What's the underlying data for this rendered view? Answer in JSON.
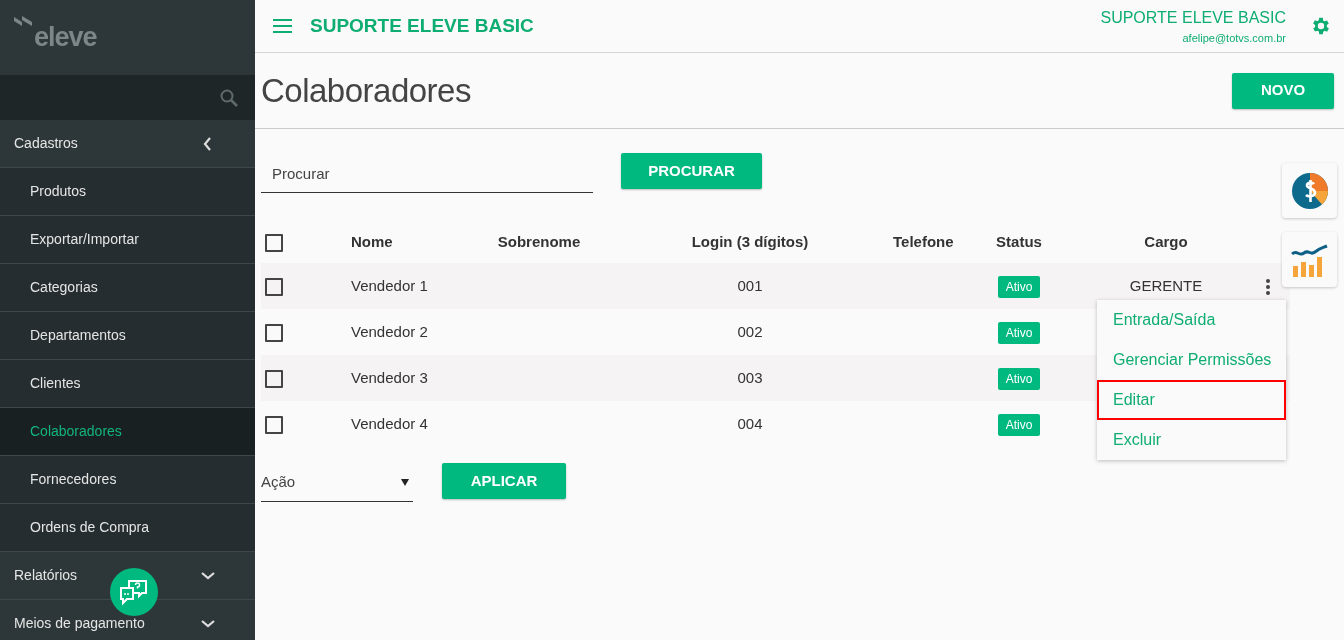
{
  "sidebar": {
    "logo": "eleve",
    "items": [
      {
        "label": "Cadastros",
        "expanded": true,
        "children": [
          {
            "label": "Produtos",
            "selected": false
          },
          {
            "label": "Exportar/Importar",
            "selected": false
          },
          {
            "label": "Categorias",
            "selected": false
          },
          {
            "label": "Departamentos",
            "selected": false
          },
          {
            "label": "Clientes",
            "selected": false
          },
          {
            "label": "Colaboradores",
            "selected": true
          },
          {
            "label": "Fornecedores",
            "selected": false
          },
          {
            "label": "Ordens de Compra",
            "selected": false
          }
        ]
      },
      {
        "label": "Relatórios",
        "expanded": false
      },
      {
        "label": "Meios de pagamento",
        "expanded": false
      }
    ]
  },
  "header": {
    "title": "SUPORTE ELEVE BASIC",
    "user_name": "SUPORTE ELEVE BASIC",
    "user_email": "afelipe@totvs.com.br"
  },
  "page": {
    "title": "Colaboradores",
    "new_button": "NOVO"
  },
  "search": {
    "placeholder": "Procurar",
    "button": "PROCURAR"
  },
  "table": {
    "columns": [
      "Nome",
      "Sobrenome",
      "Login (3 dígitos)",
      "Telefone",
      "Status",
      "Cargo"
    ],
    "rows": [
      {
        "checked": false,
        "nome": "Vendedor 1",
        "login": "001",
        "status": "Ativo",
        "cargo": "GERENTE"
      },
      {
        "checked": false,
        "nome": "Vendedor 2",
        "login": "002",
        "status": "Ativo"
      },
      {
        "checked": false,
        "nome": "Vendedor 3",
        "login": "003",
        "status": "Ativo"
      },
      {
        "checked": false,
        "nome": "Vendedor 4",
        "login": "004",
        "status": "Ativo"
      }
    ],
    "all_checked": false
  },
  "context_menu": {
    "items": [
      {
        "label": "Entrada/Saída",
        "highlighted": false
      },
      {
        "label": "Gerenciar Permissões",
        "highlighted": false
      },
      {
        "label": "Editar",
        "highlighted": true
      },
      {
        "label": "Excluir",
        "highlighted": false
      }
    ]
  },
  "bulk_action": {
    "placeholder": "Ação",
    "button": "APLICAR"
  }
}
